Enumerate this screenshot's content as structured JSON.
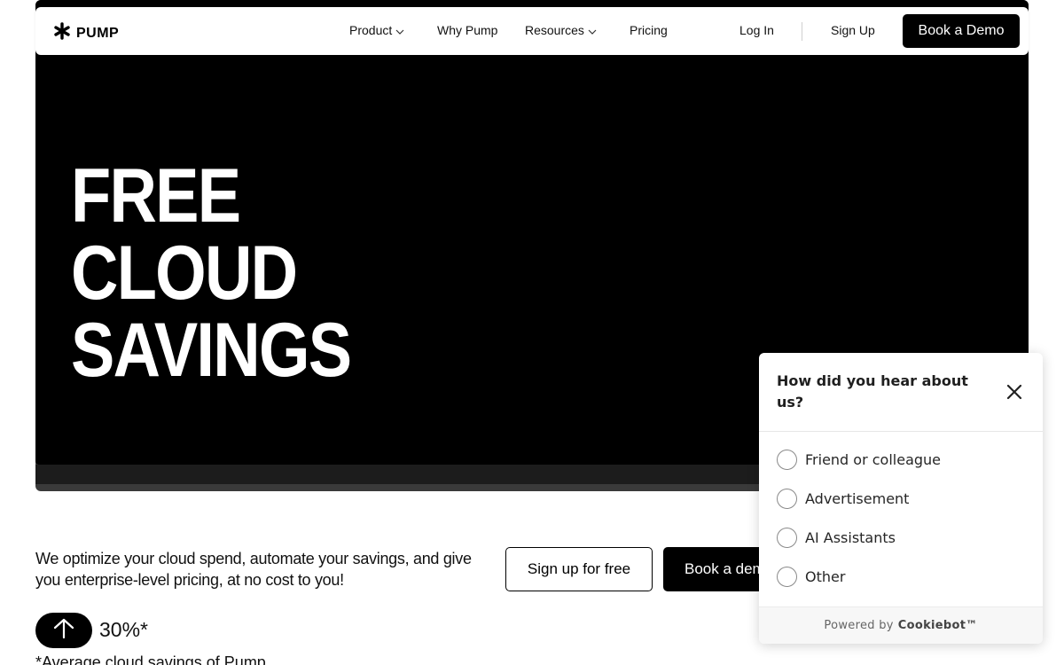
{
  "nav": {
    "logo_text": "PUMP",
    "items": [
      {
        "label": "Product",
        "has_dropdown": true
      },
      {
        "label": "Why Pump",
        "has_dropdown": false
      },
      {
        "label": "Resources",
        "has_dropdown": true
      },
      {
        "label": "Pricing",
        "has_dropdown": false
      }
    ],
    "login": "Log In",
    "signup": "Sign Up",
    "demo": "Book a Demo"
  },
  "hero": {
    "lines": [
      "FREE",
      "CLOUD",
      "SAVINGS"
    ]
  },
  "main": {
    "tagline": "We optimize your cloud spend, automate your savings, and give you enterprise-level pricing, at no cost to you!",
    "cta_primary": "Sign up for free",
    "cta_secondary": "Book a demo",
    "stat_value": "30%*",
    "stat_note": "*Average cloud savings of Pump"
  },
  "survey": {
    "question": "How did you hear about us?",
    "options": [
      "Friend or colleague",
      "Advertisement",
      "AI Assistants",
      "Other"
    ],
    "footer_prefix": "Powered by",
    "footer_brand": "Cookiebot™"
  },
  "icons": {
    "logo": "asterisk-logo-icon",
    "chevron": "chevron-down-icon",
    "arrow": "arrow-up-icon",
    "close": "close-icon"
  },
  "colors": {
    "hero_bg": "#000000",
    "button_dark": "#000000",
    "text": "#111111"
  }
}
